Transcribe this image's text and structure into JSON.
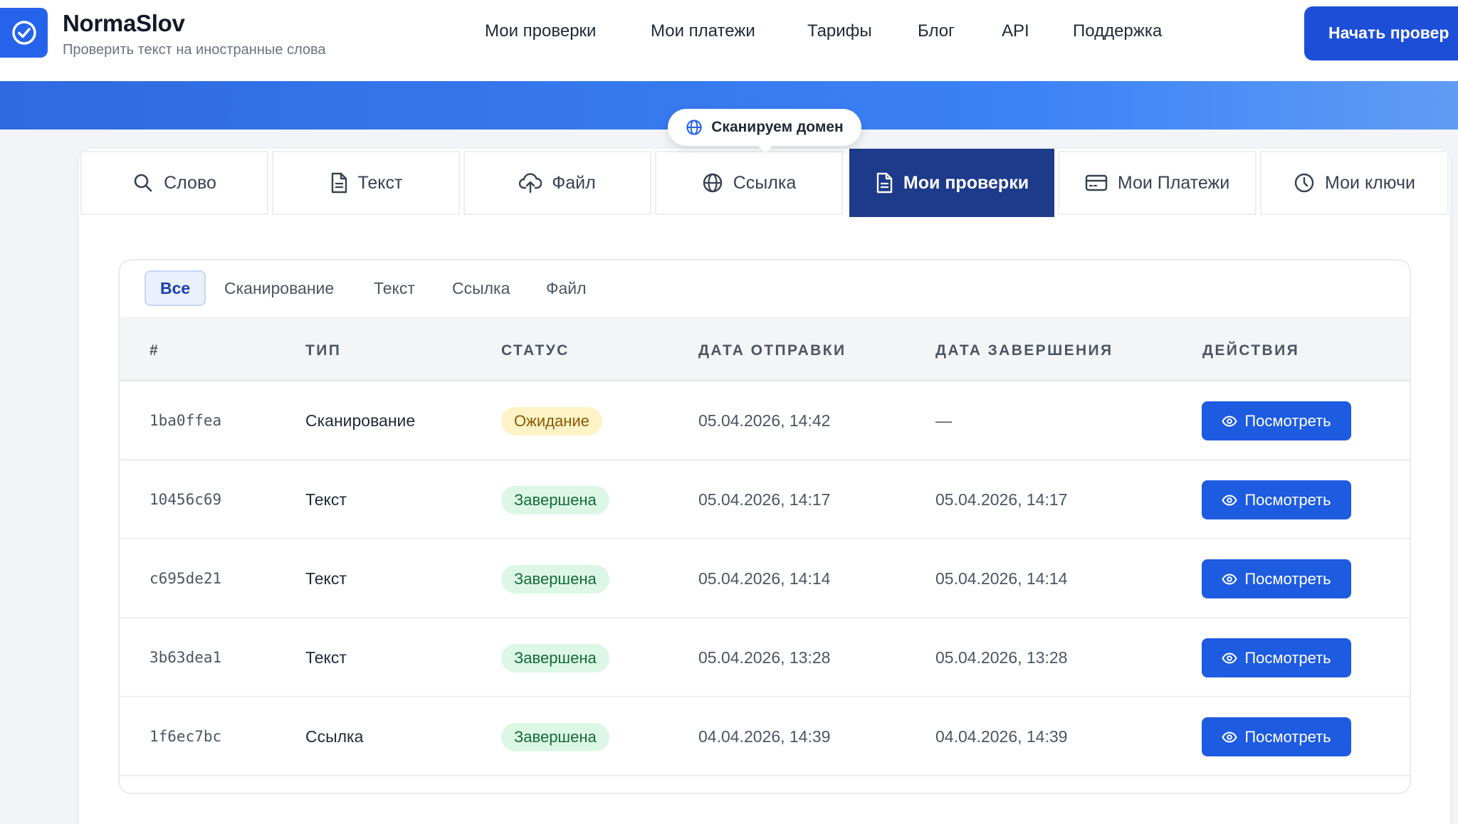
{
  "app": {
    "name": "NormaSlov",
    "tagline": "Проверить текст на иностранные слова"
  },
  "nav": {
    "links": [
      "Мои проверки",
      "Мои платежи",
      "Тарифы",
      "Блог",
      "API",
      "Поддержка"
    ],
    "cta_label": "Начать провер"
  },
  "tooltip": {
    "label": "Сканируем домен",
    "icon": "globe-icon"
  },
  "tabs": [
    {
      "label": "Слово",
      "icon": "search-icon"
    },
    {
      "label": "Текст",
      "icon": "document-icon"
    },
    {
      "label": "Файл",
      "icon": "cloud-upload-icon"
    },
    {
      "label": "Ссылка",
      "icon": "globe-icon"
    },
    {
      "label": "Мои проверки",
      "icon": "document-icon",
      "active": true
    },
    {
      "label": "Мои Платежи",
      "icon": "credit-card-icon"
    },
    {
      "label": "Мои ключи",
      "icon": "clock-icon"
    }
  ],
  "filters": [
    "Все",
    "Сканирование",
    "Текст",
    "Ссылка",
    "Файл"
  ],
  "active_filter": "Все",
  "table": {
    "headers": [
      "#",
      "ТИП",
      "СТАТУС",
      "ДАТА ОТПРАВКИ",
      "ДАТА ЗАВЕРШЕНИЯ",
      "ДЕЙСТВИЯ"
    ],
    "action_label": "Посмотреть",
    "rows": [
      {
        "id": "1ba0ffea",
        "type": "Сканирование",
        "status": "Ожидание",
        "status_kind": "pending",
        "sent": "05.04.2026, 14:42",
        "finished": "—"
      },
      {
        "id": "10456c69",
        "type": "Текст",
        "status": "Завершена",
        "status_kind": "done",
        "sent": "05.04.2026, 14:17",
        "finished": "05.04.2026, 14:17"
      },
      {
        "id": "c695de21",
        "type": "Текст",
        "status": "Завершена",
        "status_kind": "done",
        "sent": "05.04.2026, 14:14",
        "finished": "05.04.2026, 14:14"
      },
      {
        "id": "3b63dea1",
        "type": "Текст",
        "status": "Завершена",
        "status_kind": "done",
        "sent": "05.04.2026, 13:28",
        "finished": "05.04.2026, 13:28"
      },
      {
        "id": "1f6ec7bc",
        "type": "Ссылка",
        "status": "Завершена",
        "status_kind": "done",
        "sent": "04.04.2026, 14:39",
        "finished": "04.04.2026, 14:39"
      }
    ]
  },
  "colors": {
    "primary": "#1d4ed8",
    "active_tab": "#1e3a8a",
    "pending_bg": "#fdf3c7",
    "done_bg": "#dcf7e6"
  }
}
